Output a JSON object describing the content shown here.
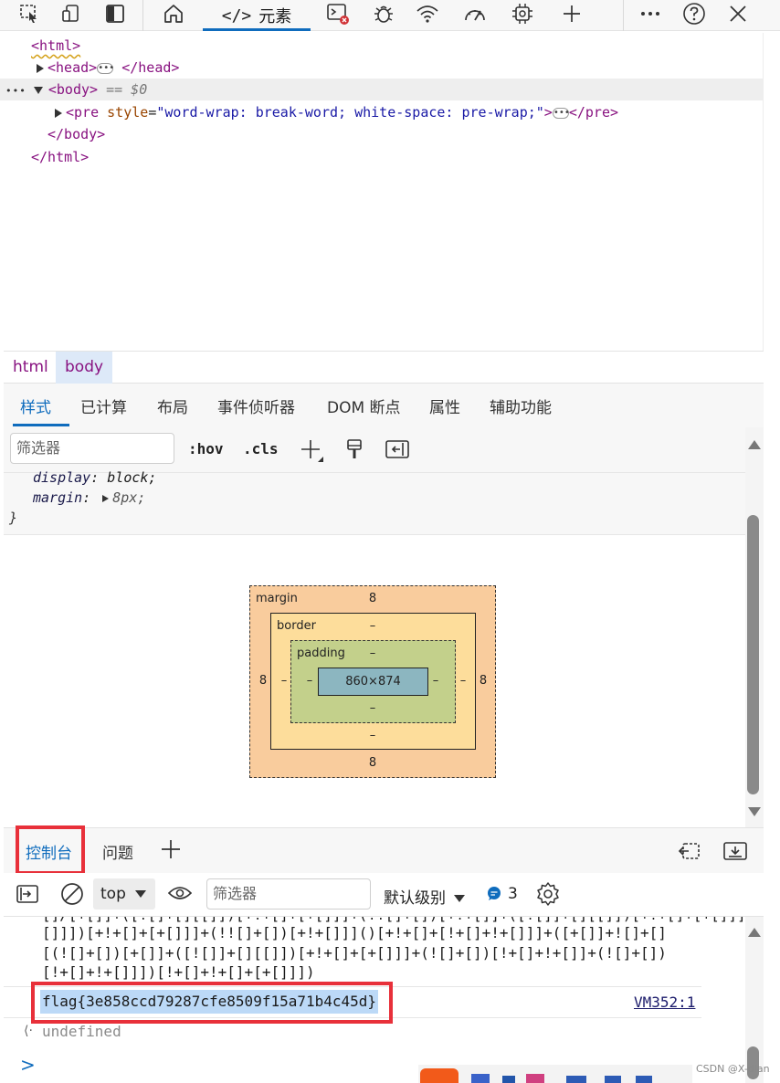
{
  "toolbar": {
    "elements_tab_label": "元素",
    "icons": [
      "inspect-icon",
      "device-emulation-icon",
      "sidebar-toggle-icon",
      "home-icon",
      "code-icon",
      "console-error-icon",
      "bug-icon",
      "wifi-icon",
      "performance-icon",
      "memory-chip-icon",
      "add-icon",
      "more-icon",
      "help-icon",
      "close-icon"
    ]
  },
  "dom": {
    "html_open": "<html>",
    "head_open": "<head>",
    "head_close": "</head>",
    "body_open": "<body>",
    "body_selected_marker": "== $0",
    "row_dots": "•••",
    "pre_open": "<pre",
    "pre_attr_name": "style",
    "pre_attr_value": "\"word-wrap: break-word; white-space: pre-wrap;\"",
    "pre_open_end": ">",
    "pre_close": "</pre>",
    "body_close": "</body>",
    "html_close": "</html>",
    "ellipsis": "•••"
  },
  "breadcrumb": {
    "items": [
      "html",
      "body"
    ]
  },
  "style_tabs": [
    "样式",
    "已计算",
    "布局",
    "事件侦听器",
    "DOM 断点",
    "属性",
    "辅助功能"
  ],
  "styles_filter": {
    "placeholder": "筛选器",
    "hov": ":hov",
    "cls": ".cls"
  },
  "css_rule": {
    "display_name": "display",
    "display_value": "block;",
    "margin_name": "margin",
    "margin_value": "8px;",
    "colon": ":",
    "close_brace": "}"
  },
  "box_model": {
    "margin_label": "margin",
    "margin_top": "8",
    "margin_left": "8",
    "margin_right": "8",
    "margin_bottom": "8",
    "border_label": "border",
    "border_top": "–",
    "border_left": "–",
    "border_right": "–",
    "border_bottom": "–",
    "padding_label": "padding",
    "padding_top": "–",
    "padding_left": "–",
    "padding_right": "–",
    "padding_bottom": "–",
    "content_size": "860×874",
    "colors": {
      "margin": "#f9cc9d",
      "border": "#fddd9b",
      "padding": "#c3d08b",
      "content": "#8cb6c0"
    }
  },
  "console_tabs": {
    "active": "控制台",
    "issues": "问题"
  },
  "console_toolbar": {
    "context": "top",
    "filter_placeholder": "筛选器",
    "levels": "默认级别",
    "message_count": "3"
  },
  "console_output": {
    "lines": [
      "[]/[+[]]+([![]+[][[]])[+!+[]+[+[]]]+(!![]+[])[+!+[]]+([![]]+[][[]])[+!+[]+[+[]]]+",
      "[]]])[+!+[]+[+[]]]+(!![]+[])[+!+[]]]()[+!+[]+[!+[]+!+[]]]+([+[]]+![]+[]",
      "[(![]+[])[+[]]+([![]]+[][[]])[+!+[]+[+[]]]+(![]+[])[!+[]+!+[]]+(![]+[])",
      "[!+[]+!+[]]])[!+[]+!+[]+[+[]]])"
    ],
    "flag": "flag{3e858ccd79287cfe8509f15a71b4c45d}",
    "source": "VM352:1",
    "undefined_text": "undefined",
    "prompt": ">"
  },
  "watermark": "CSDN @X-dian",
  "accent_color": "#0f6cbd",
  "highlight_color": "#e8303a"
}
